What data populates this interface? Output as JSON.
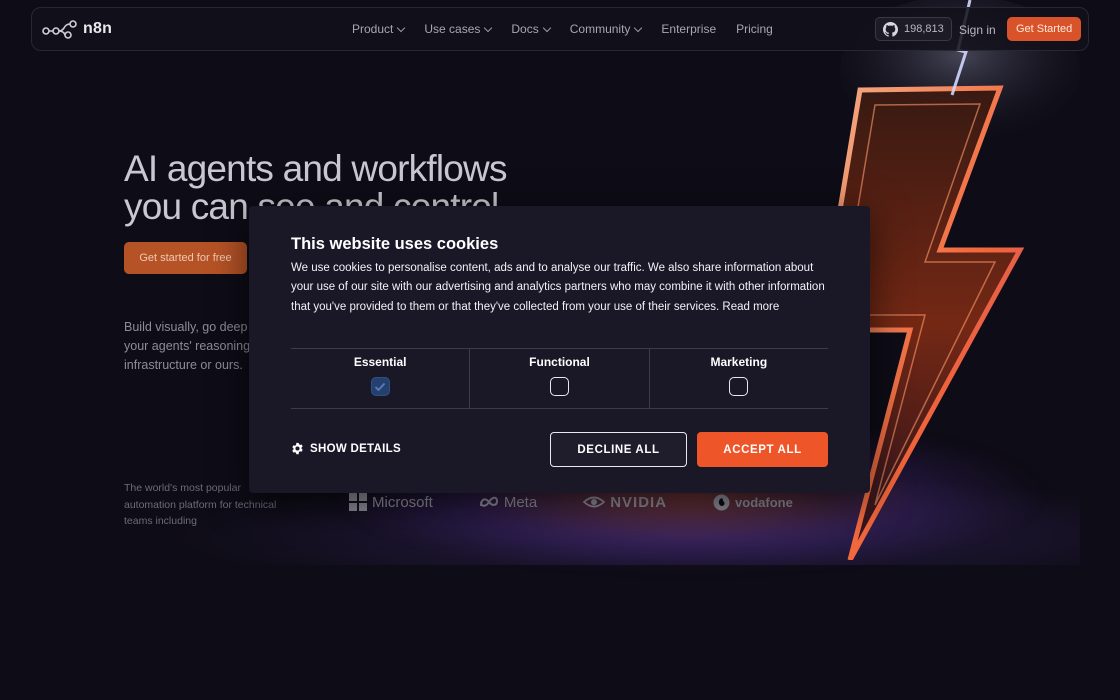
{
  "nav": {
    "logo_text": "n8n",
    "links": [
      {
        "label": "Product",
        "has_dropdown": true
      },
      {
        "label": "Use cases",
        "has_dropdown": true
      },
      {
        "label": "Docs",
        "has_dropdown": true
      },
      {
        "label": "Community",
        "has_dropdown": true
      },
      {
        "label": "Enterprise",
        "has_dropdown": false
      },
      {
        "label": "Pricing",
        "has_dropdown": false
      }
    ],
    "github_stars": "198,813",
    "sign_in": "Sign in",
    "get_started": "Get Started"
  },
  "hero": {
    "title_line1": "AI agents and workflows",
    "title_line2": "you can see and control",
    "cta": "Get started for free",
    "description": "Build visually, go deep your agents' reasoning infrastructure or ours.",
    "trust_text": "The world's most popular automation platform for technical teams including",
    "brands": [
      "Microsoft",
      "Meta",
      "NVIDIA",
      "vodafone"
    ]
  },
  "cookie": {
    "title": "This website uses cookies",
    "body": "We use cookies to personalise content, ads and to analyse our traffic. We also share information about your use of our site with our advertising and analytics partners who may combine it with other information that you've provided to them or that they've collected from your use of their services.",
    "read_more": "Read more",
    "categories": [
      {
        "label": "Essential",
        "checked": true
      },
      {
        "label": "Functional",
        "checked": false
      },
      {
        "label": "Marketing",
        "checked": false
      }
    ],
    "show_details": "SHOW DETAILS",
    "decline": "DECLINE ALL",
    "accept": "ACCEPT ALL"
  },
  "colors": {
    "background": "#0e0c16",
    "accent": "#ee5529",
    "modal_bg": "#1a1727",
    "checkbox_checked": "#23406e"
  }
}
